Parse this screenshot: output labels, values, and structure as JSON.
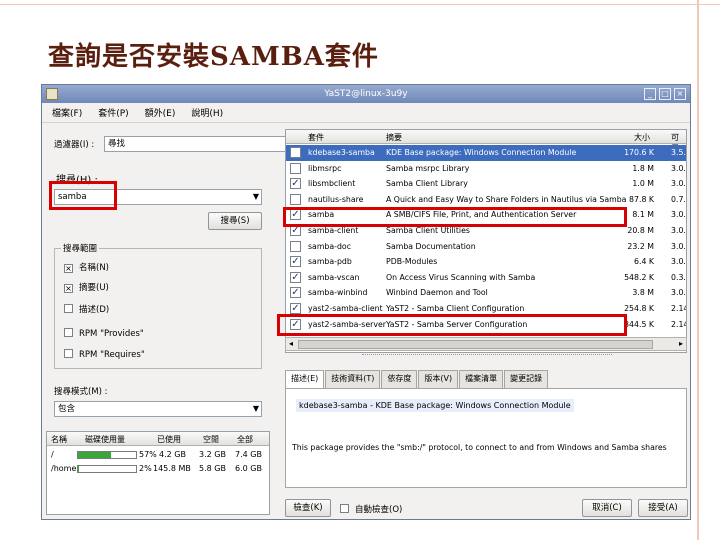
{
  "slide": {
    "title": "查詢是否安裝SAMBA套件"
  },
  "window": {
    "title": "YaST2@linux-3u9y",
    "menu": [
      "檔案(F)",
      "套件(P)",
      "額外(E)",
      "說明(H)"
    ]
  },
  "filter": {
    "label": "過濾器(I) :",
    "value": "尋找"
  },
  "search": {
    "label": "搜尋(H) :",
    "value": "samba",
    "button": "搜尋(S)"
  },
  "search_scope": {
    "title": "搜尋範圍",
    "options": [
      {
        "label": "名稱(N)",
        "checked": true
      },
      {
        "label": "摘要(U)",
        "checked": true
      },
      {
        "label": "描述(D)",
        "checked": false
      },
      {
        "label": "RPM \"Provides\"",
        "checked": false
      },
      {
        "label": "RPM \"Requires\"",
        "checked": false
      }
    ]
  },
  "search_mode": {
    "label": "搜尋模式(M) :",
    "value": "包含"
  },
  "packages": {
    "headers": {
      "name": "套件",
      "summary": "摘要",
      "size": "大小",
      "version": "可用"
    },
    "rows": [
      {
        "name": "kdebase3-samba",
        "summary": "KDE Base package: Windows Connection Module",
        "size": "170.6 K",
        "version": "3.5.",
        "checked": false,
        "selected": true
      },
      {
        "name": "libmsrpc",
        "summary": "Samba msrpc Library",
        "size": "1.8 M",
        "version": "3.0.",
        "checked": false,
        "selected": false
      },
      {
        "name": "libsmbclient",
        "summary": "Samba Client Library",
        "size": "1.0 M",
        "version": "3.0.",
        "checked": true,
        "selected": false
      },
      {
        "name": "nautilus-share",
        "summary": "A Quick and Easy Way to Share Folders in Nautilus via Samba",
        "size": "87.8 K",
        "version": "0.7.",
        "checked": false,
        "selected": false
      },
      {
        "name": "samba",
        "summary": "A SMB/CIFS File, Print, and Authentication Server",
        "size": "8.1 M",
        "version": "3.0.",
        "checked": true,
        "selected": false
      },
      {
        "name": "samba-client",
        "summary": "Samba Client Utilities",
        "size": "20.8 M",
        "version": "3.0.",
        "checked": true,
        "selected": false
      },
      {
        "name": "samba-doc",
        "summary": "Samba Documentation",
        "size": "23.2 M",
        "version": "3.0.",
        "checked": false,
        "selected": false
      },
      {
        "name": "samba-pdb",
        "summary": "PDB-Modules",
        "size": "6.4 K",
        "version": "3.0.",
        "checked": true,
        "selected": false
      },
      {
        "name": "samba-vscan",
        "summary": "On Access Virus Scanning with Samba",
        "size": "548.2 K",
        "version": "0.3.",
        "checked": true,
        "selected": false
      },
      {
        "name": "samba-winbind",
        "summary": "Winbind Daemon and Tool",
        "size": "3.8 M",
        "version": "3.0.",
        "checked": true,
        "selected": false
      },
      {
        "name": "yast2-samba-client",
        "summary": "YaST2 - Samba Client Configuration",
        "size": "254.8 K",
        "version": "2.14.",
        "checked": true,
        "selected": false
      },
      {
        "name": "yast2-samba-server",
        "summary": "YaST2 - Samba Server Configuration",
        "size": "344.5 K",
        "version": "2.14.",
        "checked": true,
        "selected": false
      }
    ]
  },
  "tabs": [
    "描述(E)",
    "技術資料(T)",
    "依存度",
    "版本(V)",
    "檔案清單",
    "變更記錄"
  ],
  "description": {
    "title": "kdebase3-samba - KDE Base package: Windows Connection Module",
    "text": "This package provides the \"smb:/\" protocol, to connect to and from Windows and Samba shares"
  },
  "disk": {
    "headers": [
      "名稱",
      "磁碟使用量",
      "已使用",
      "空閒",
      "全部"
    ],
    "rows": [
      {
        "name": "/",
        "percent": "57%",
        "usage": 0.57,
        "used": "4.2 GB",
        "free": "3.2 GB",
        "total": "7.4 GB"
      },
      {
        "name": "/home",
        "percent": "2%",
        "usage": 0.02,
        "used": "145.8 MB",
        "free": "5.8 GB",
        "total": "6.0 GB"
      }
    ]
  },
  "footer": {
    "check": "檢查(K)",
    "autocheck": "自動檢查(O)",
    "cancel": "取消(C)",
    "accept": "接受(A)"
  }
}
